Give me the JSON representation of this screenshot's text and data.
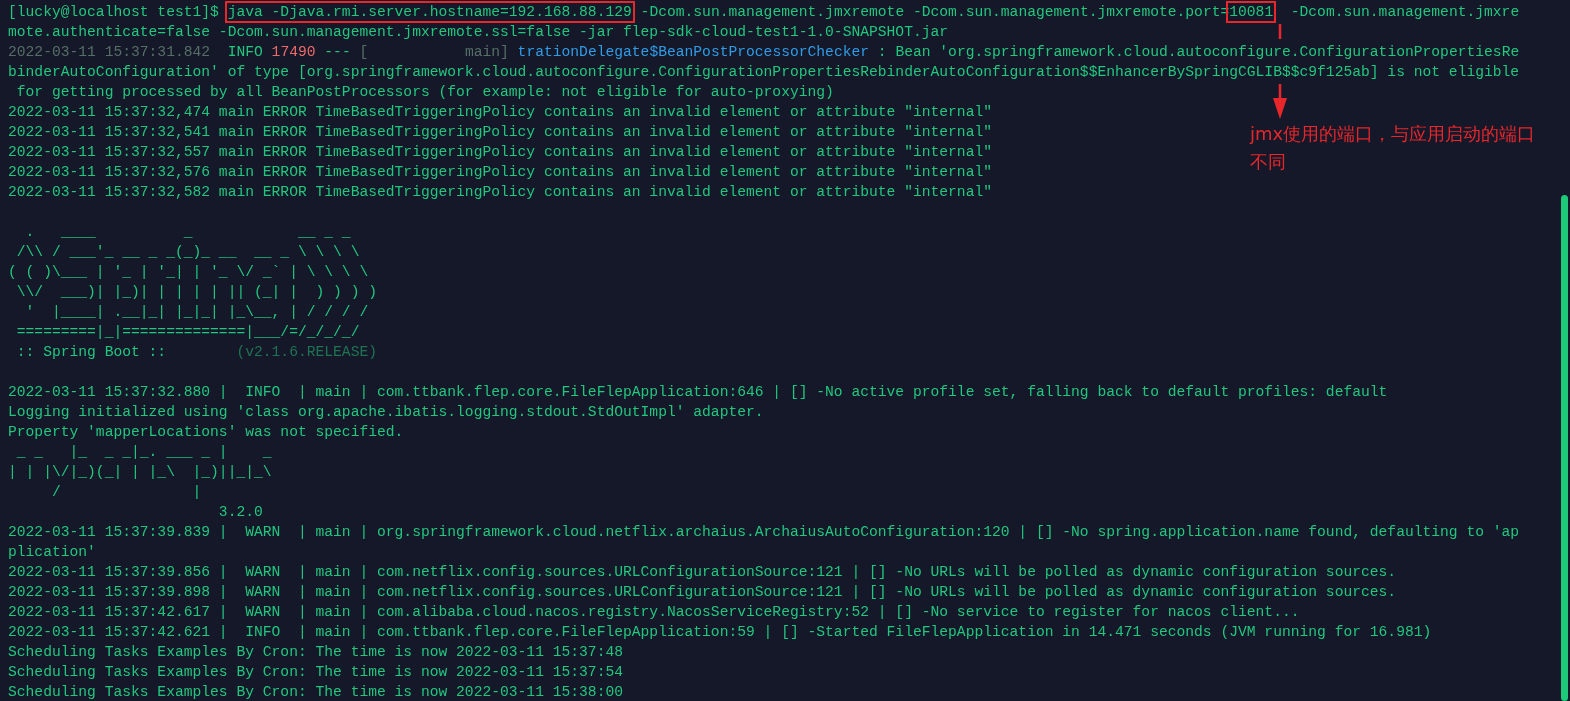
{
  "terminal": {
    "lines": [
      {
        "segments": [
          {
            "kind": "normal",
            "text": "[lucky@localhost test1]$ "
          },
          {
            "kind": "boxed",
            "text": "java -Djava.rmi.server.hostname=192.168.88.129"
          },
          {
            "kind": "normal",
            "text": " -Dcom.sun.management.jmxremote -Dcom.sun.management.jmxremote.port="
          },
          {
            "kind": "boxed",
            "text": "10081"
          },
          {
            "kind": "normal",
            "text": "  -Dcom.sun.management.jmxre"
          }
        ]
      },
      {
        "segments": [
          {
            "kind": "normal",
            "text": "mote.authenticate=false -Dcom.sun.management.jmxremote.ssl=false -jar flep-sdk-cloud-test1-1.0-SNAPSHOT.jar"
          }
        ]
      },
      {
        "segments": [
          {
            "kind": "dim",
            "text": "2022-03-11 15:37:31.842"
          },
          {
            "kind": "normal",
            "text": "  INFO "
          },
          {
            "kind": "red",
            "text": "17490"
          },
          {
            "kind": "normal",
            "text": " --- "
          },
          {
            "kind": "dim",
            "text": "[           main]"
          },
          {
            "kind": "blue",
            "text": " trationDelegate$BeanPostProcessorChecker"
          },
          {
            "kind": "normal",
            "text": " : Bean 'org.springframework.cloud.autoconfigure.ConfigurationPropertiesRe"
          }
        ]
      },
      {
        "segments": [
          {
            "kind": "normal",
            "text": "binderAutoConfiguration' of type [org.springframework.cloud.autoconfigure.ConfigurationPropertiesRebinderAutoConfiguration$$EnhancerBySpringCGLIB$$c9f125ab] is not eligible"
          }
        ]
      },
      {
        "segments": [
          {
            "kind": "normal",
            "text": " for getting processed by all BeanPostProcessors (for example: not eligible for auto-proxying)"
          }
        ]
      },
      {
        "segments": [
          {
            "kind": "normal",
            "text": "2022-03-11 15:37:32,474 main ERROR TimeBasedTriggeringPolicy contains an invalid element or attribute \"internal\""
          }
        ]
      },
      {
        "segments": [
          {
            "kind": "normal",
            "text": "2022-03-11 15:37:32,541 main ERROR TimeBasedTriggeringPolicy contains an invalid element or attribute \"internal\""
          }
        ]
      },
      {
        "segments": [
          {
            "kind": "normal",
            "text": "2022-03-11 15:37:32,557 main ERROR TimeBasedTriggeringPolicy contains an invalid element or attribute \"internal\""
          }
        ]
      },
      {
        "segments": [
          {
            "kind": "normal",
            "text": "2022-03-11 15:37:32,576 main ERROR TimeBasedTriggeringPolicy contains an invalid element or attribute \"internal\""
          }
        ]
      },
      {
        "segments": [
          {
            "kind": "normal",
            "text": "2022-03-11 15:37:32,582 main ERROR TimeBasedTriggeringPolicy contains an invalid element or attribute \"internal\""
          }
        ]
      },
      {
        "blank": true
      },
      {
        "segments": [
          {
            "kind": "normal",
            "text": "  .   ____          _            __ _ _"
          }
        ]
      },
      {
        "segments": [
          {
            "kind": "normal",
            "text": " /\\\\ / ___'_ __ _ _(_)_ __  __ _ \\ \\ \\ \\"
          }
        ]
      },
      {
        "segments": [
          {
            "kind": "normal",
            "text": "( ( )\\___ | '_ | '_| | '_ \\/ _` | \\ \\ \\ \\"
          }
        ]
      },
      {
        "segments": [
          {
            "kind": "normal",
            "text": " \\\\/  ___)| |_)| | | | | || (_| |  ) ) ) )"
          }
        ]
      },
      {
        "segments": [
          {
            "kind": "normal",
            "text": "  '  |____| .__|_| |_|_| |_\\__, | / / / /"
          }
        ]
      },
      {
        "segments": [
          {
            "kind": "normal",
            "text": " =========|_|==============|___/=/_/_/_/"
          }
        ]
      },
      {
        "segments": [
          {
            "kind": "normal",
            "text": " :: Spring Boot ::        "
          },
          {
            "kind": "faint",
            "text": "(v2.1.6.RELEASE)"
          }
        ]
      },
      {
        "blank": true
      },
      {
        "segments": [
          {
            "kind": "normal",
            "text": "2022-03-11 15:37:32.880 |  INFO  | main | com.ttbank.flep.core.FileFlepApplication:646 | [] -No active profile set, falling back to default profiles: default"
          }
        ]
      },
      {
        "segments": [
          {
            "kind": "normal",
            "text": "Logging initialized using 'class org.apache.ibatis.logging.stdout.StdOutImpl' adapter."
          }
        ]
      },
      {
        "segments": [
          {
            "kind": "normal",
            "text": "Property 'mapperLocations' was not specified."
          }
        ]
      },
      {
        "segments": [
          {
            "kind": "normal",
            "text": " _ _   |_  _ _|_. ___ _ |    _"
          }
        ]
      },
      {
        "segments": [
          {
            "kind": "normal",
            "text": "| | |\\/|_)(_| | |_\\  |_)||_|_\\"
          }
        ]
      },
      {
        "segments": [
          {
            "kind": "normal",
            "text": "     /               |"
          }
        ]
      },
      {
        "segments": [
          {
            "kind": "normal",
            "text": "                        3.2.0"
          }
        ]
      },
      {
        "segments": [
          {
            "kind": "normal",
            "text": "2022-03-11 15:37:39.839 |  WARN  | main | org.springframework.cloud.netflix.archaius.ArchaiusAutoConfiguration:120 | [] -No spring.application.name found, defaulting to 'ap"
          }
        ]
      },
      {
        "segments": [
          {
            "kind": "normal",
            "text": "plication'"
          }
        ]
      },
      {
        "segments": [
          {
            "kind": "normal",
            "text": "2022-03-11 15:37:39.856 |  WARN  | main | com.netflix.config.sources.URLConfigurationSource:121 | [] -No URLs will be polled as dynamic configuration sources."
          }
        ]
      },
      {
        "segments": [
          {
            "kind": "normal",
            "text": "2022-03-11 15:37:39.898 |  WARN  | main | com.netflix.config.sources.URLConfigurationSource:121 | [] -No URLs will be polled as dynamic configuration sources."
          }
        ]
      },
      {
        "segments": [
          {
            "kind": "normal",
            "text": "2022-03-11 15:37:42.617 |  WARN  | main | com.alibaba.cloud.nacos.registry.NacosServiceRegistry:52 | [] -No service to register for nacos client..."
          }
        ]
      },
      {
        "segments": [
          {
            "kind": "normal",
            "text": "2022-03-11 15:37:42.621 |  INFO  | main | com.ttbank.flep.core.FileFlepApplication:59 | [] -Started FileFlepApplication in 14.471 seconds (JVM running for 16.981)"
          }
        ]
      },
      {
        "segments": [
          {
            "kind": "normal",
            "text": "Scheduling Tasks Examples By Cron: The time is now 2022-03-11 15:37:48"
          }
        ]
      },
      {
        "segments": [
          {
            "kind": "normal",
            "text": "Scheduling Tasks Examples By Cron: The time is now 2022-03-11 15:37:54"
          }
        ]
      },
      {
        "segments": [
          {
            "kind": "normal",
            "text": "Scheduling Tasks Examples By Cron: The time is now 2022-03-11 15:38:00"
          }
        ]
      }
    ]
  },
  "annotation": {
    "text": "jmx使用的端口，与应用启动的端口不同"
  }
}
